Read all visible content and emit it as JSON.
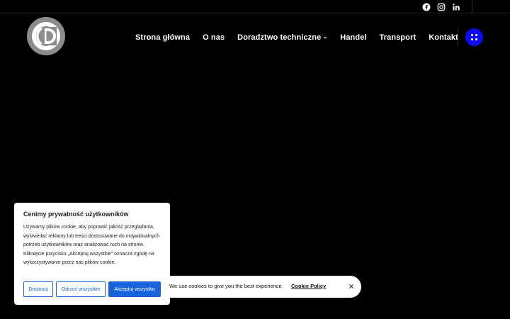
{
  "header": {
    "social": [
      {
        "icon": "facebook-icon"
      },
      {
        "icon": "instagram-icon"
      },
      {
        "icon": "linkedin-icon"
      }
    ],
    "logo": {
      "icon": "cd-logo-icon"
    },
    "nav": [
      {
        "label": "Strona główna"
      },
      {
        "label": "O nas"
      },
      {
        "label": "Doradztwo techniczne",
        "has_dropdown": true
      },
      {
        "label": "Handel"
      },
      {
        "label": "Transport"
      },
      {
        "label": "Kontakt"
      }
    ],
    "menu_button": {
      "icon": "grid-dots-icon",
      "color": "#0a0aff"
    }
  },
  "cookie_consent": {
    "title": "Cenimy prywatność użytkowników",
    "text": "Używamy plików cookie, aby poprawić jakość przeglądania, wyświetlać reklamy lub treści dostosowane do indywidualnych potrzeb użytkowników oraz analizować ruch na stronie. Kliknięcie przycisku „Akceptuj wszystkie” oznacza zgodę na wykorzystywanie przez nas plików cookie.",
    "buttons": {
      "customize": "Dostosuj",
      "reject": "Odrzuć wszystkie",
      "accept": "Akceptuj wszystko"
    },
    "accent_color": "#1863dc"
  },
  "cookie_bar": {
    "text": "We use cookies to give you the best experience.",
    "link": "Cookie Policy",
    "close_icon": "close-icon"
  },
  "colors": {
    "background": "#000000",
    "text": "#ffffff"
  }
}
